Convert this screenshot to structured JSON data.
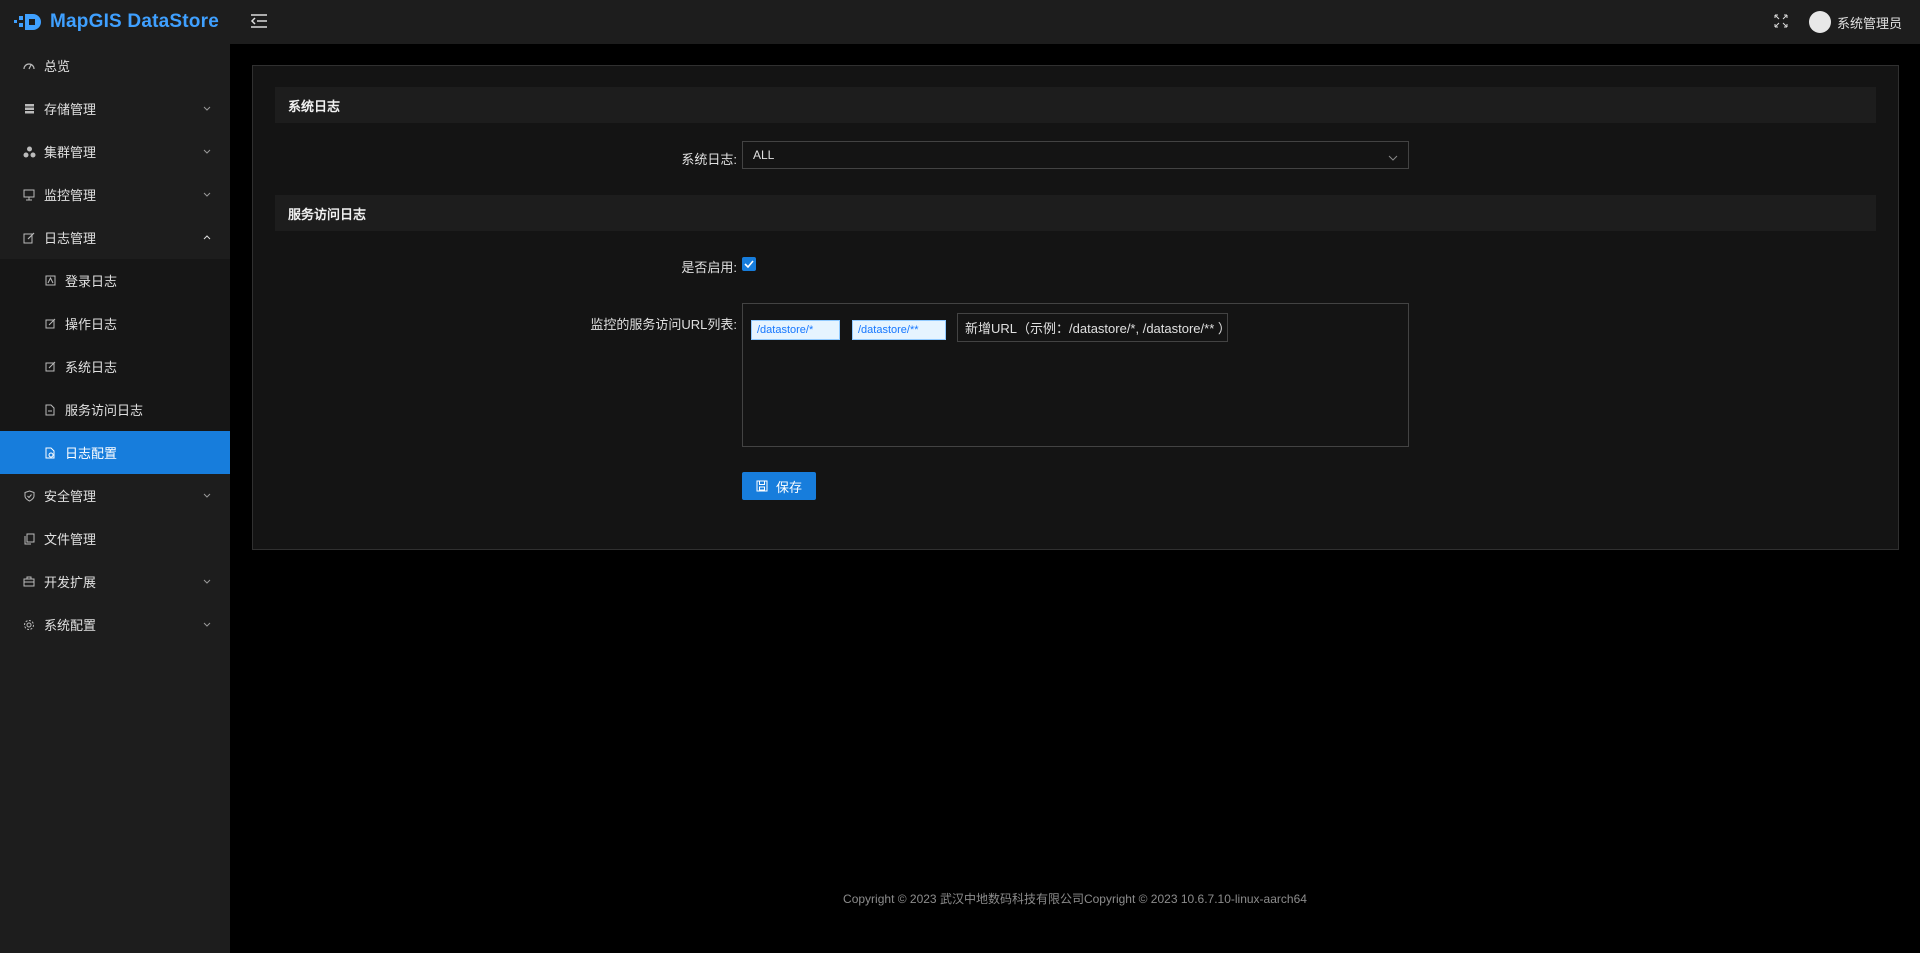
{
  "app": {
    "title": "MapGIS DataStore"
  },
  "sidebar": {
    "items": [
      {
        "label": "总览",
        "icon": "dashboard-icon"
      },
      {
        "label": "存储管理",
        "icon": "database-icon"
      },
      {
        "label": "集群管理",
        "icon": "cluster-icon"
      },
      {
        "label": "监控管理",
        "icon": "monitor-icon"
      },
      {
        "label": "日志管理",
        "icon": "edit-icon"
      },
      {
        "label": "安全管理",
        "icon": "shield-icon"
      },
      {
        "label": "文件管理",
        "icon": "copy-icon"
      },
      {
        "label": "开发扩展",
        "icon": "briefcase-icon"
      },
      {
        "label": "系统配置",
        "icon": "gear-icon"
      }
    ],
    "log_submenu": [
      {
        "label": "登录日志",
        "icon": "login-log-icon"
      },
      {
        "label": "操作日志",
        "icon": "operation-log-icon"
      },
      {
        "label": "系统日志",
        "icon": "system-log-icon"
      },
      {
        "label": "服务访问日志",
        "icon": "file-icon"
      },
      {
        "label": "日志配置",
        "icon": "log-config-icon"
      }
    ]
  },
  "header": {
    "user_name": "系统管理员"
  },
  "system_log_section": {
    "title": "系统日志",
    "field_label": "系统日志:",
    "select_value": "ALL"
  },
  "service_log_section": {
    "title": "服务访问日志",
    "enabled_label": "是否启用:",
    "enabled": true,
    "url_list_label": "监控的服务访问URL列表:",
    "urls": [
      "/datastore/*",
      "/datastore/**"
    ],
    "new_url_text": "新增URL（示例：/datastore/*, /datastore/** ）"
  },
  "actions": {
    "save_label": "保存"
  },
  "footer": {
    "text": "Copyright © 2023 武汉中地数码科技有限公司Copyright © 2023 10.6.7.10-linux-aarch64"
  },
  "colors": {
    "accent": "#177ddc",
    "sidebar_bg": "#1d1d1d",
    "panel_bg": "#141414",
    "logo": "#3fa0ff"
  }
}
